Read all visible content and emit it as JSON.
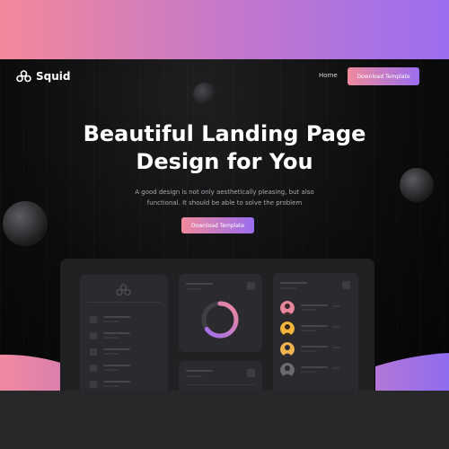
{
  "brand": {
    "name": "Squid",
    "logo_icon": "squid-logo-icon"
  },
  "nav": {
    "home_label": "Home",
    "cta_label": "Download Template"
  },
  "hero": {
    "title_line1": "Beautiful Landing Page",
    "title_line2": "Design for You",
    "subtitle_line1": "A good design is not only aesthetically pleasing, but also",
    "subtitle_line2": "functional. It should be able to solve the problem",
    "cta_label": "Download Template"
  },
  "colors": {
    "accent_start": "#f18a9c",
    "accent_end": "#9a6df0",
    "hero_background": "#0b0b0c",
    "card_background": "#2b2b2f"
  },
  "dashboard": {
    "donut_progress": 0.65,
    "avatar_colors": [
      "#e8869b",
      "#f4b63a",
      "#f0b24d",
      "#6a6a6e"
    ]
  }
}
